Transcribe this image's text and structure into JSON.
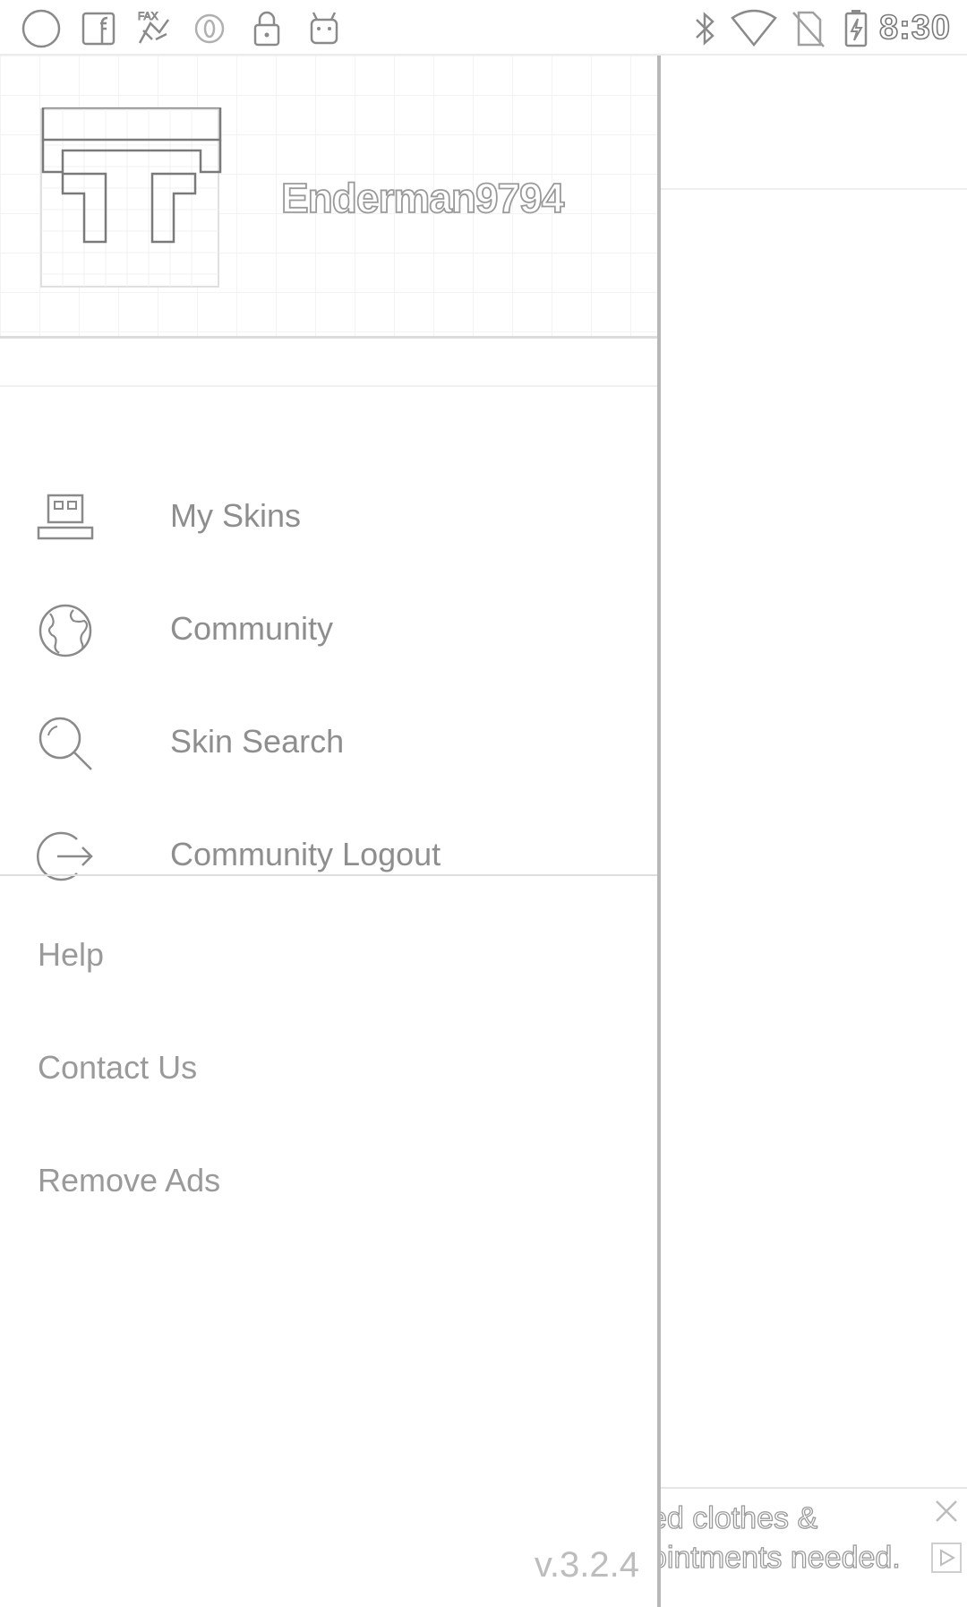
{
  "status_bar": {
    "left_icons": [
      "circle-icon",
      "facebook-icon",
      "fax-icon",
      "opera-icon",
      "lock-icon",
      "android-icon"
    ],
    "right_icons": [
      "bluetooth-icon",
      "wifi-icon",
      "no-sim-icon",
      "battery-charging-icon"
    ],
    "time": "8:30"
  },
  "drawer": {
    "username": "Enderman9794",
    "nav_items": [
      {
        "label": "My Skins",
        "icon": "computer-icon"
      },
      {
        "label": "Community",
        "icon": "globe-icon"
      },
      {
        "label": "Skin Search",
        "icon": "search-icon"
      },
      {
        "label": "Community Logout",
        "icon": "logout-icon"
      }
    ],
    "secondary_items": [
      {
        "label": "Help"
      },
      {
        "label": "Contact Us"
      },
      {
        "label": "Remove Ads"
      }
    ],
    "version": "v.3.2.4"
  },
  "ad": {
    "line1": "ed clothes &",
    "line2": "ointments needed."
  }
}
